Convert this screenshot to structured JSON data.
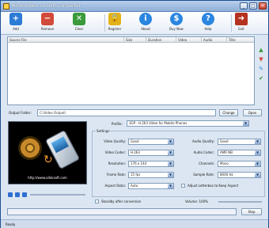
{
  "window": {
    "title": "Allok Video to 3GP Converter",
    "minimize": "_",
    "maximize": "□",
    "close": "×"
  },
  "toolbar": {
    "buttons": [
      {
        "label": "Add",
        "icon": "film-add-icon",
        "color": "#2c7bd5"
      },
      {
        "label": "Remove",
        "icon": "film-remove-icon",
        "color": "#d24a3a"
      },
      {
        "label": "Clear",
        "icon": "clear-list-icon",
        "color": "#3a9a3a"
      },
      {
        "label": "Register",
        "icon": "lock-icon",
        "color": "#e3b21a"
      },
      {
        "label": "About",
        "icon": "info-icon",
        "color": "#2a86e0"
      },
      {
        "label": "Buy Now",
        "icon": "buy-icon",
        "color": "#2a86e0"
      },
      {
        "label": "Help",
        "icon": "help-icon",
        "color": "#2a86e0"
      },
      {
        "label": "Exit",
        "icon": "exit-door-icon",
        "color": "#b4321f"
      }
    ]
  },
  "filelist": {
    "columns": [
      "Source File",
      "Size",
      "Duration",
      "Video",
      "Audio",
      "Title"
    ]
  },
  "output": {
    "label": "Output Folder:",
    "value": "C:\\Video Output\\",
    "browse": "Change",
    "open": "Open"
  },
  "preview": {
    "url": "http://www.alloksoft.com"
  },
  "settings": {
    "profile_label": "Profile:",
    "profile_value": "3GP - H.263 Video for Mobile Phones",
    "group_caption": "Settings",
    "left": [
      {
        "label": "Video Quality:",
        "value": "Good"
      },
      {
        "label": "Video Codec:",
        "value": "H.263"
      },
      {
        "label": "Resolution:",
        "value": "176 x 144"
      },
      {
        "label": "Frame Rate:",
        "value": "15 fps"
      },
      {
        "label": "Aspect Ratio:",
        "value": "Auto"
      }
    ],
    "right": [
      {
        "label": "Audio Quality:",
        "value": "Good"
      },
      {
        "label": "Audio Codec:",
        "value": "AMR NB"
      },
      {
        "label": "Channels:",
        "value": "Mono"
      },
      {
        "label": "Sample Rate:",
        "value": "8000 Hz"
      }
    ],
    "keep_aspect": "Adjust Letterbox to Keep Aspect"
  },
  "bottom": {
    "stop": "Stop",
    "standby": "Standby after conversion",
    "volume_label": "Volume: 100%"
  },
  "status": {
    "text": "Ready"
  }
}
